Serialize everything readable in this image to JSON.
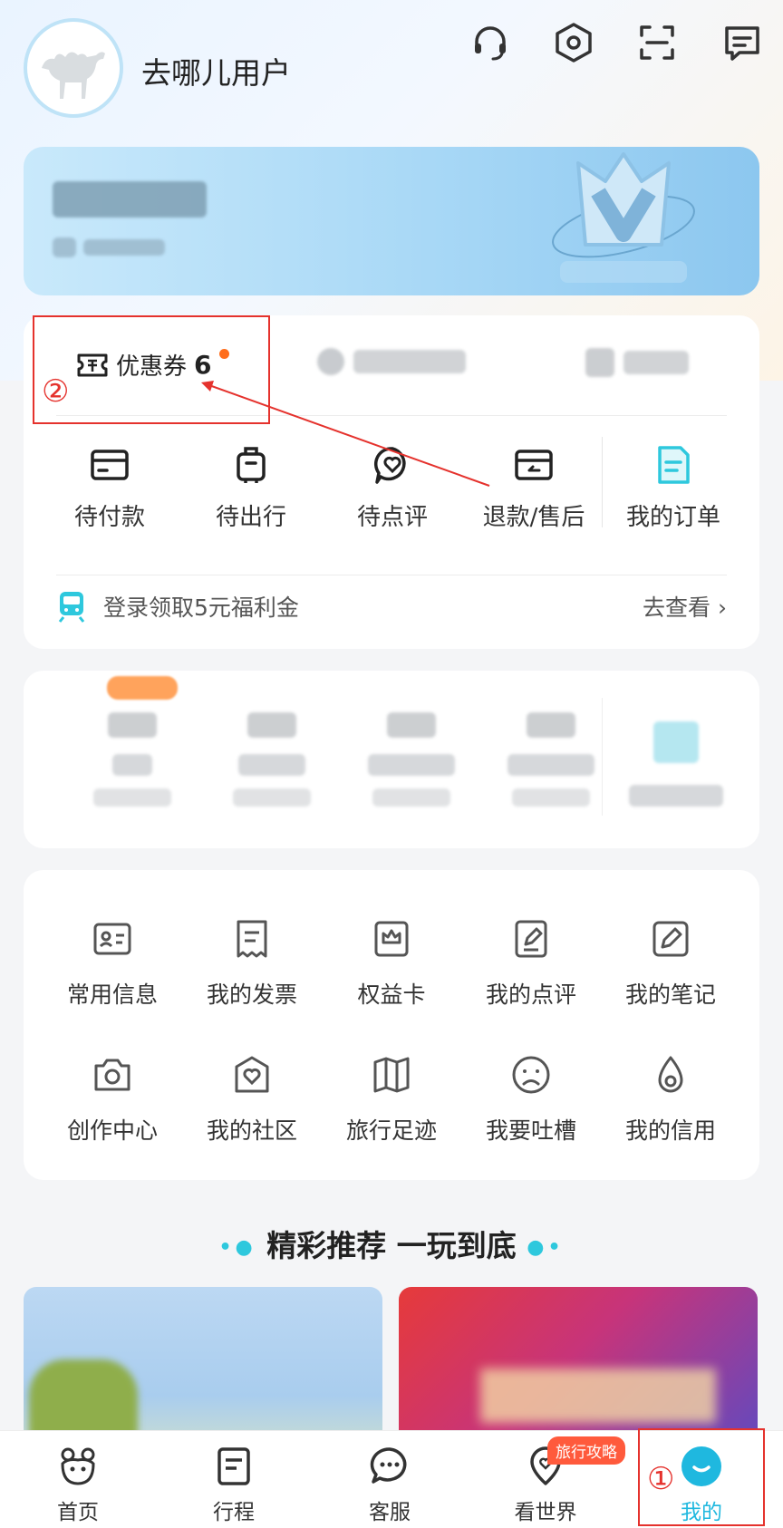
{
  "header": {
    "username": "去哪儿用户",
    "icons": [
      "headset-icon",
      "settings-hex-icon",
      "scan-icon",
      "message-icon"
    ]
  },
  "coupons": {
    "label": "优惠券",
    "count": "6"
  },
  "orders": {
    "items": [
      {
        "label": "待付款",
        "icon": "wallet-card-icon"
      },
      {
        "label": "待出行",
        "icon": "luggage-icon"
      },
      {
        "label": "待点评",
        "icon": "review-heart-icon"
      },
      {
        "label": "退款/售后",
        "icon": "refund-icon"
      },
      {
        "label": "我的订单",
        "icon": "order-doc-icon"
      }
    ]
  },
  "promo": {
    "text": "登录领取5元福利金",
    "link": "去查看"
  },
  "tools": {
    "row1": [
      {
        "label": "常用信息",
        "icon": "id-card-icon"
      },
      {
        "label": "我的发票",
        "icon": "invoice-icon"
      },
      {
        "label": "权益卡",
        "icon": "crown-card-icon"
      },
      {
        "label": "我的点评",
        "icon": "edit-review-icon"
      },
      {
        "label": "我的笔记",
        "icon": "pen-note-icon"
      }
    ],
    "row2": [
      {
        "label": "创作中心",
        "icon": "camera-icon"
      },
      {
        "label": "我的社区",
        "icon": "community-heart-icon"
      },
      {
        "label": "旅行足迹",
        "icon": "map-icon"
      },
      {
        "label": "我要吐槽",
        "icon": "sad-face-icon"
      },
      {
        "label": "我的信用",
        "icon": "credit-drop-icon"
      }
    ]
  },
  "recommend": {
    "title": "精彩推荐 一玩到底"
  },
  "annotations": {
    "one": "①",
    "two": "②"
  },
  "bottom_nav": {
    "items": [
      {
        "label": "首页",
        "icon": "home-camel-icon"
      },
      {
        "label": "行程",
        "icon": "itinerary-icon"
      },
      {
        "label": "客服",
        "icon": "chat-icon"
      },
      {
        "label": "看世界",
        "icon": "location-pin-icon",
        "badge": "旅行攻略"
      },
      {
        "label": "我的",
        "icon": "me-smile-icon",
        "active": true
      }
    ]
  },
  "colors": {
    "accent": "#2ec8dd",
    "active_nav": "#1fb8df",
    "badge": "#ff6d1b",
    "annotation": "#e5322d"
  }
}
